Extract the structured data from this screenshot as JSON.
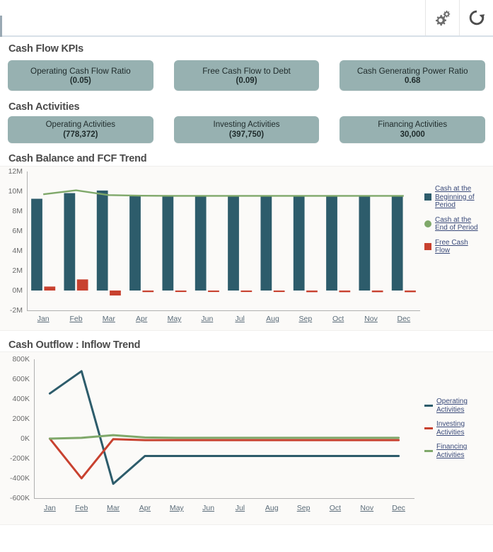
{
  "toolbar": {
    "settings_icon": "gear-icon",
    "settings_label": "Settings",
    "refresh_icon": "refresh-icon",
    "refresh_label": "Refresh"
  },
  "sections": {
    "kpi_title": "Cash Flow KPIs",
    "activities_title": "Cash Activities"
  },
  "kpi_cards": [
    {
      "label": "Operating Cash Flow Ratio",
      "value": "(0.05)"
    },
    {
      "label": "Free Cash Flow to Debt",
      "value": "(0.09)"
    },
    {
      "label": "Cash Generating Power Ratio",
      "value": "0.68"
    }
  ],
  "activity_cards": [
    {
      "label": "Operating Activities",
      "value": "(778,372)"
    },
    {
      "label": "Investing Activities",
      "value": "(397,750)"
    },
    {
      "label": "Financing Activities",
      "value": "30,000"
    }
  ],
  "colors": {
    "card_bg": "#97b1b1",
    "cash_beginning": "#2d5c6b",
    "cash_end": "#7fa86a",
    "free_cash_flow": "#c8412f",
    "panel_bg": "#fbfaf8",
    "heading": "#4a4a4a",
    "legend_link": "#3a4a7a"
  },
  "chart_data": [
    {
      "type": "bar",
      "title": "Cash Balance and FCF Trend",
      "xlabel": "",
      "ylabel": "",
      "ylim": [
        -2000000,
        12000000
      ],
      "ytick_labels": [
        "12M",
        "10M",
        "8M",
        "6M",
        "4M",
        "2M",
        "0M",
        "-2M"
      ],
      "ytick_values": [
        12000000,
        10000000,
        8000000,
        6000000,
        4000000,
        2000000,
        0,
        -2000000
      ],
      "grid": false,
      "legend_position": "right",
      "categories": [
        "Jan",
        "Feb",
        "Mar",
        "Apr",
        "May",
        "Jun",
        "Jul",
        "Aug",
        "Sep",
        "Oct",
        "Nov",
        "Dec"
      ],
      "series": [
        {
          "name": "Cash at the Beginning of Period",
          "render": "bar",
          "color": "#2d5c6b",
          "values": [
            9250000,
            9820000,
            10080000,
            9520000,
            9520000,
            9520000,
            9520000,
            9520000,
            9520000,
            9520000,
            9520000,
            9520000
          ]
        },
        {
          "name": "Cash at the End of Period",
          "render": "line",
          "color": "#7fa86a",
          "values": [
            9700000,
            10100000,
            9620000,
            9560000,
            9540000,
            9540000,
            9540000,
            9540000,
            9540000,
            9540000,
            9540000,
            9540000
          ]
        },
        {
          "name": "Free Cash Flow",
          "render": "bar",
          "color": "#c8412f",
          "values": [
            400000,
            1120000,
            -500000,
            -160000,
            -150000,
            -150000,
            -150000,
            -150000,
            -170000,
            -170000,
            -170000,
            -170000
          ]
        }
      ]
    },
    {
      "type": "line",
      "title": "Cash Outflow : Inflow Trend",
      "xlabel": "",
      "ylabel": "",
      "ylim": [
        -600000,
        800000
      ],
      "ytick_labels": [
        "800K",
        "600K",
        "400K",
        "200K",
        "0K",
        "-200K",
        "-400K",
        "-600K"
      ],
      "ytick_values": [
        800000,
        600000,
        400000,
        200000,
        0,
        -200000,
        -400000,
        -600000
      ],
      "grid": false,
      "legend_position": "right",
      "categories": [
        "Jan",
        "Feb",
        "Mar",
        "Apr",
        "May",
        "Jun",
        "Jul",
        "Aug",
        "Sep",
        "Oct",
        "Nov",
        "Dec"
      ],
      "series": [
        {
          "name": "Operating Activities",
          "color": "#2d5c6b",
          "values": [
            455000,
            680000,
            -455000,
            -175000,
            -175000,
            -175000,
            -175000,
            -175000,
            -175000,
            -175000,
            -175000,
            -175000
          ]
        },
        {
          "name": "Investing Activities",
          "color": "#c8412f",
          "values": [
            0,
            -400000,
            -5000,
            -15000,
            -15000,
            -15000,
            -15000,
            -15000,
            -15000,
            -15000,
            -15000,
            -15000
          ]
        },
        {
          "name": "Financing Activities",
          "color": "#7fa86a",
          "values": [
            0,
            8000,
            35000,
            12000,
            8000,
            8000,
            8000,
            8000,
            8000,
            8000,
            8000,
            8000
          ]
        }
      ]
    }
  ]
}
